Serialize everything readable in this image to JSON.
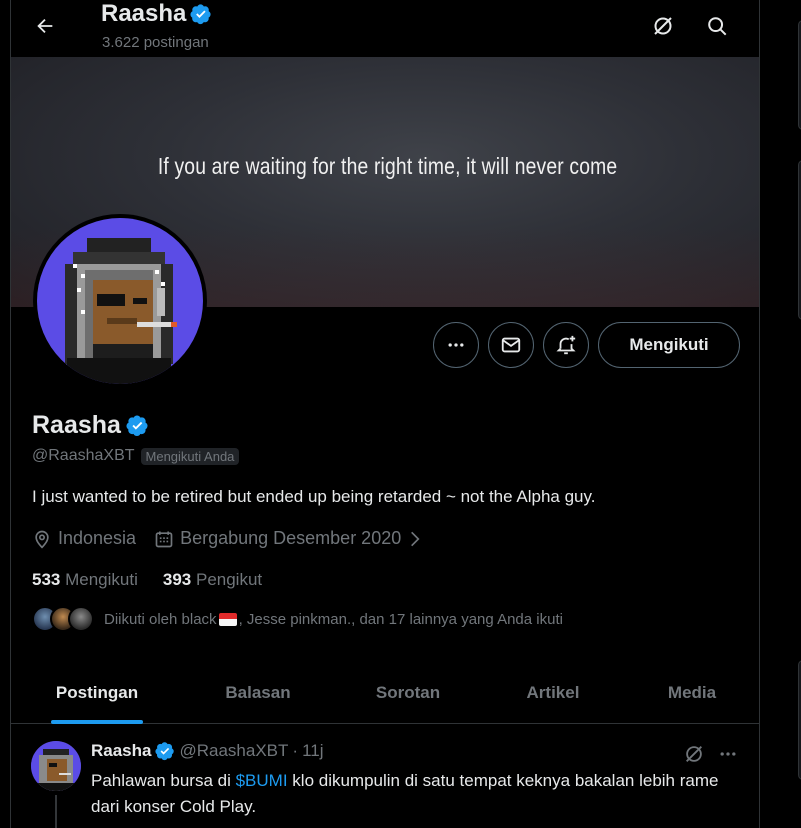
{
  "header": {
    "name": "Raasha",
    "post_count": "3.622 postingan"
  },
  "banner": {
    "quote": "If you are waiting for the right time, it will never come"
  },
  "actions": {
    "follow_label": "Mengikuti"
  },
  "profile": {
    "name": "Raasha",
    "handle": "@RaashaXBT",
    "follows_you": "Mengikuti Anda",
    "bio": "I just wanted to be retired but ended up being retarded ~ not the Alpha guy.",
    "location": "Indonesia",
    "joined": "Bergabung Desember 2020",
    "following_count": "533",
    "following_label": "Mengikuti",
    "followers_count": "393",
    "followers_label": "Pengikut",
    "followed_by_prefix": "Diikuti oleh black",
    "followed_by_suffix": ", Jesse pinkman., dan 17 lainnya yang Anda ikuti"
  },
  "tabs": [
    {
      "label": "Postingan",
      "active": true
    },
    {
      "label": "Balasan",
      "active": false
    },
    {
      "label": "Sorotan",
      "active": false
    },
    {
      "label": "Artikel",
      "active": false
    },
    {
      "label": "Media",
      "active": false
    }
  ],
  "tweet": {
    "name": "Raasha",
    "handle": "@RaashaXBT",
    "dot": "·",
    "time": "11j",
    "text_before": "Pahlawan bursa di ",
    "cashtag": "$BUMI",
    "text_after": " klo dikumpulin di satu tempat keknya bakalan lebih rame dari konser Cold Play."
  },
  "colors": {
    "accent": "#1d9bf0",
    "background": "#000000",
    "secondary_text": "#71767b",
    "avatar_bg": "#5b4ce6"
  },
  "icons": [
    "back-arrow-icon",
    "grok-icon",
    "search-icon",
    "verified-badge-icon",
    "more-icon",
    "message-icon",
    "notification-bell-icon",
    "location-pin-icon",
    "calendar-icon",
    "chevron-right-icon",
    "grok-icon",
    "more-icon"
  ]
}
